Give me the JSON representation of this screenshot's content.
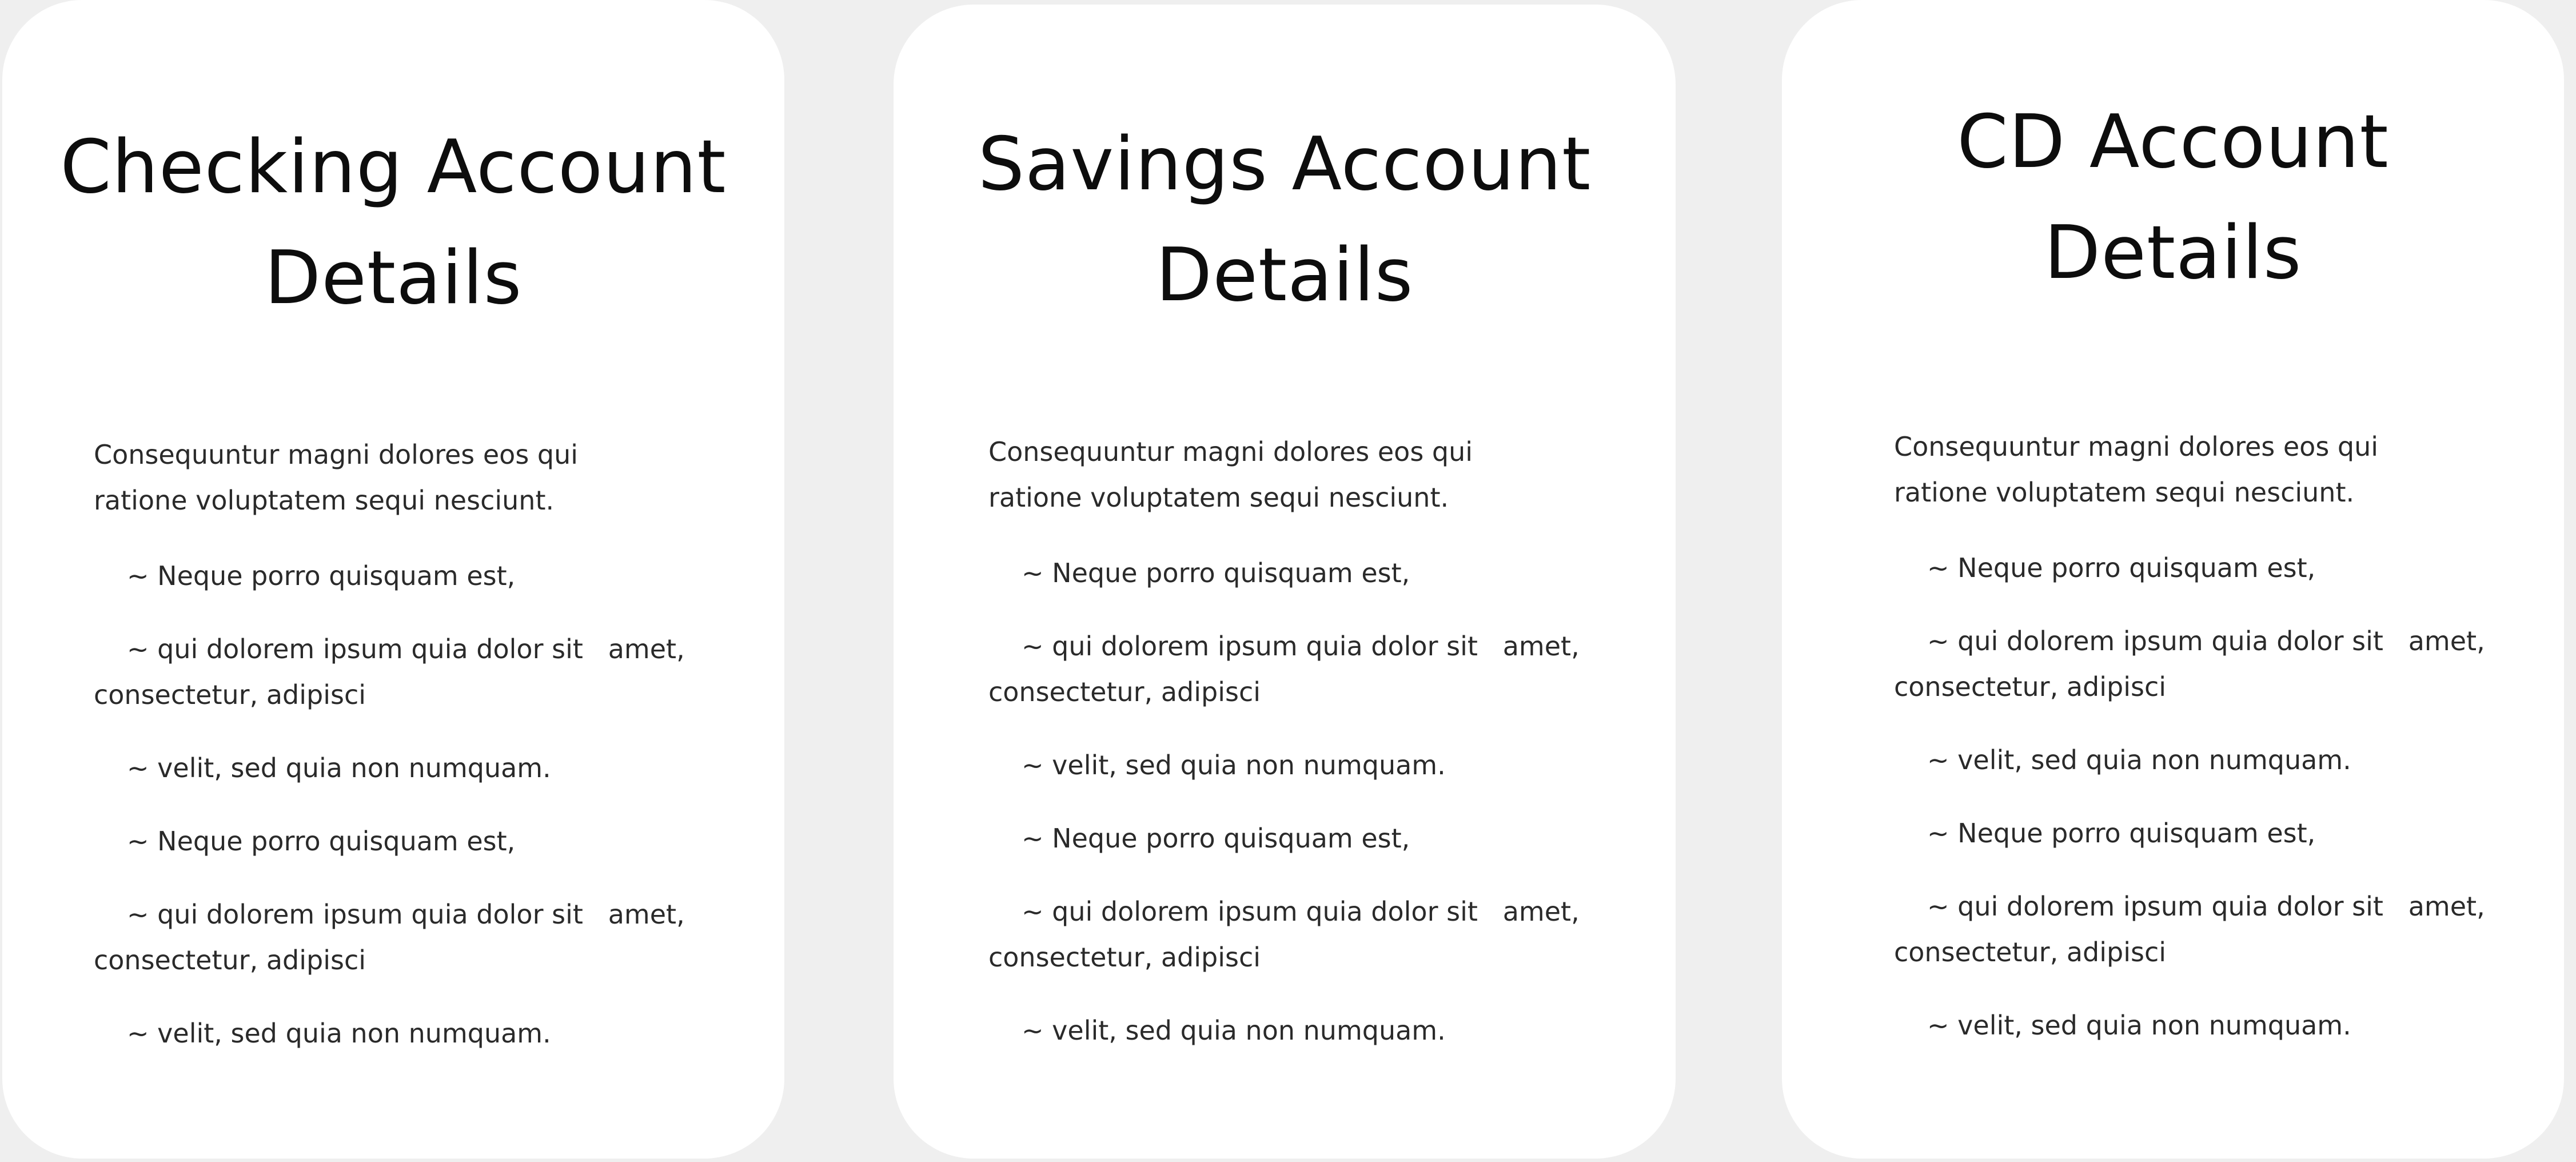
{
  "cards": [
    {
      "title_line1": "Checking Account",
      "title_line2": "Details",
      "intro_line1": "Consequuntur magni dolores eos qui",
      "intro_line2": "ratione voluptatem sequi nesciunt.",
      "items": [
        "~ Neque porro quisquam est,",
        "~ qui dolorem ipsum quia dolor sit   amet, consectetur, adipisci",
        "~ velit, sed quia non numquam.",
        "~ Neque porro quisquam est,",
        "~ qui dolorem ipsum quia dolor sit   amet, consectetur, adipisci",
        "~ velit, sed quia non numquam."
      ]
    },
    {
      "title_line1": "Savings Account",
      "title_line2": "Details",
      "intro_line1": "Consequuntur magni dolores eos qui",
      "intro_line2": "ratione voluptatem sequi nesciunt.",
      "items": [
        "~ Neque porro quisquam est,",
        "~ qui dolorem ipsum quia dolor sit   amet, consectetur, adipisci",
        "~ velit, sed quia non numquam.",
        "~ Neque porro quisquam est,",
        "~ qui dolorem ipsum quia dolor sit   amet, consectetur, adipisci",
        "~ velit, sed quia non numquam."
      ]
    },
    {
      "title_line1": "CD Account",
      "title_line2": "Details",
      "intro_line1": "Consequuntur magni dolores eos qui",
      "intro_line2": "ratione voluptatem sequi nesciunt.",
      "items": [
        "~ Neque porro quisquam est,",
        "~ qui dolorem ipsum quia dolor sit   amet, consectetur, adipisci",
        "~ velit, sed quia non numquam.",
        "~ Neque porro quisquam est,",
        "~ qui dolorem ipsum quia dolor sit   amet, consectetur, adipisci",
        "~ velit, sed quia non numquam."
      ]
    }
  ]
}
